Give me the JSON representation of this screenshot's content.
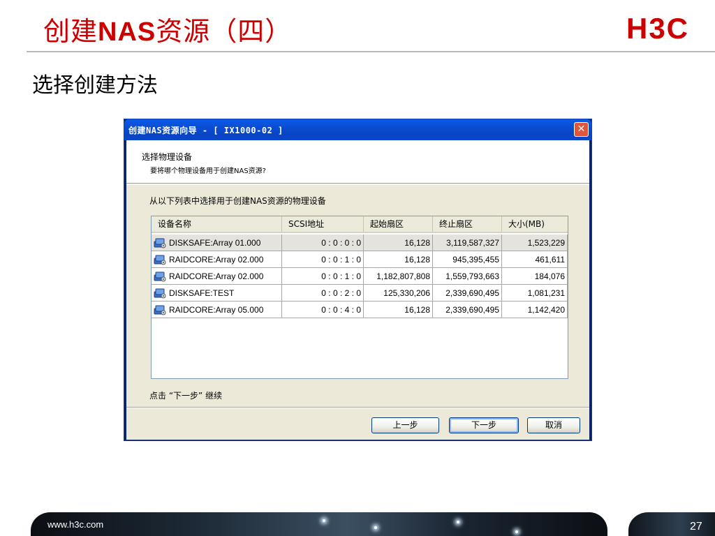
{
  "slide": {
    "title_prefix": "创建",
    "title_bold": "NAS",
    "title_suffix": "资源（四）",
    "subtitle": "选择创建方法",
    "logo_text": "H3C",
    "footer_url": "www.h3c.com",
    "page_number": "27"
  },
  "dialog": {
    "title": "创建NAS资源向导 - [ IX1000-02 ]",
    "close_glyph": "✕",
    "header_title": "选择物理设备",
    "header_subtitle": "要将哪个物理设备用于创建NAS资源?",
    "list_caption": "从以下列表中选择用于创建NAS资源的物理设备",
    "columns": [
      "设备名称",
      "SCSI地址",
      "起始扇区",
      "终止扇区",
      "大小(MB)"
    ],
    "rows": [
      {
        "name": "DISKSAFE:Array 01.000",
        "scsi": "0 : 0 : 0 : 0",
        "start": "16,128",
        "end": "3,119,587,327",
        "size": "1,523,229"
      },
      {
        "name": "RAIDCORE:Array 02.000",
        "scsi": "0 : 0 : 1 : 0",
        "start": "16,128",
        "end": "945,395,455",
        "size": "461,611"
      },
      {
        "name": "RAIDCORE:Array 02.000",
        "scsi": "0 : 0 : 1 : 0",
        "start": "1,182,807,808",
        "end": "1,559,793,663",
        "size": "184,076"
      },
      {
        "name": "DISKSAFE:TEST",
        "scsi": "0 : 0 : 2 : 0",
        "start": "125,330,206",
        "end": "2,339,690,495",
        "size": "1,081,231"
      },
      {
        "name": "RAIDCORE:Array 05.000",
        "scsi": "0 : 0 : 4 : 0",
        "start": "16,128",
        "end": "2,339,690,495",
        "size": "1,142,420"
      }
    ],
    "row_icon": "storage-device-icon",
    "hint": "点击 “下一步” 继续",
    "buttons": {
      "back": "上一步",
      "next": "下一步",
      "cancel": "取消"
    }
  },
  "colors": {
    "title_red": "#cc0000",
    "titlebar_blue": "#0a4cd2",
    "close_red": "#e1553a",
    "dialog_bg": "#ece9d8"
  }
}
